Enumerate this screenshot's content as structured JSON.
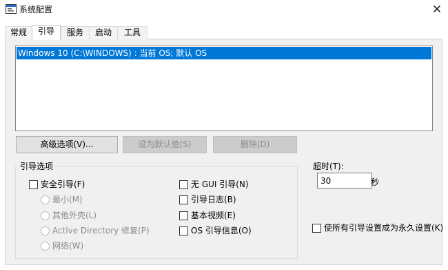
{
  "window": {
    "title": "系统配置",
    "close_glyph": "✕"
  },
  "tabs": [
    {
      "label": "常规",
      "active": false
    },
    {
      "label": "引导",
      "active": true
    },
    {
      "label": "服务",
      "active": false
    },
    {
      "label": "启动",
      "active": false
    },
    {
      "label": "工具",
      "active": false
    }
  ],
  "os_list": {
    "entries": [
      "Windows 10 (C:\\WINDOWS) : 当前 OS; 默认 OS"
    ],
    "selected_index": 0
  },
  "buttons": {
    "advanced": "高级选项(V)...",
    "set_default": "设为默认值(S)",
    "delete": "删除(D)"
  },
  "boot_options": {
    "title": "引导选项",
    "safe_boot": {
      "label": "安全引导(F)",
      "checked": false
    },
    "safe_modes": [
      {
        "label": "最小(M)",
        "enabled": false
      },
      {
        "label": "其他外壳(L)",
        "enabled": false
      },
      {
        "label": "Active Directory 修复(P)",
        "enabled": false
      },
      {
        "label": "网络(W)",
        "enabled": false
      }
    ],
    "no_gui": {
      "label": "无 GUI 引导(N)",
      "checked": false
    },
    "boot_log": {
      "label": "引导日志(B)",
      "checked": false
    },
    "base_video": {
      "label": "基本视频(E)",
      "checked": false
    },
    "os_info": {
      "label": "OS 引导信息(O)",
      "checked": false
    }
  },
  "timeout": {
    "label": "超时(T):",
    "value": "30",
    "unit": "秒"
  },
  "make_permanent": {
    "label": "使所有引导设置成为永久设置(K)",
    "checked": false
  },
  "colors": {
    "selection": "#0078d7",
    "panel_bg": "#f0f0f0",
    "disabled_text": "#8b8b8b"
  },
  "icons": {
    "app": "msconfig-window-icon",
    "close": "close-icon"
  }
}
